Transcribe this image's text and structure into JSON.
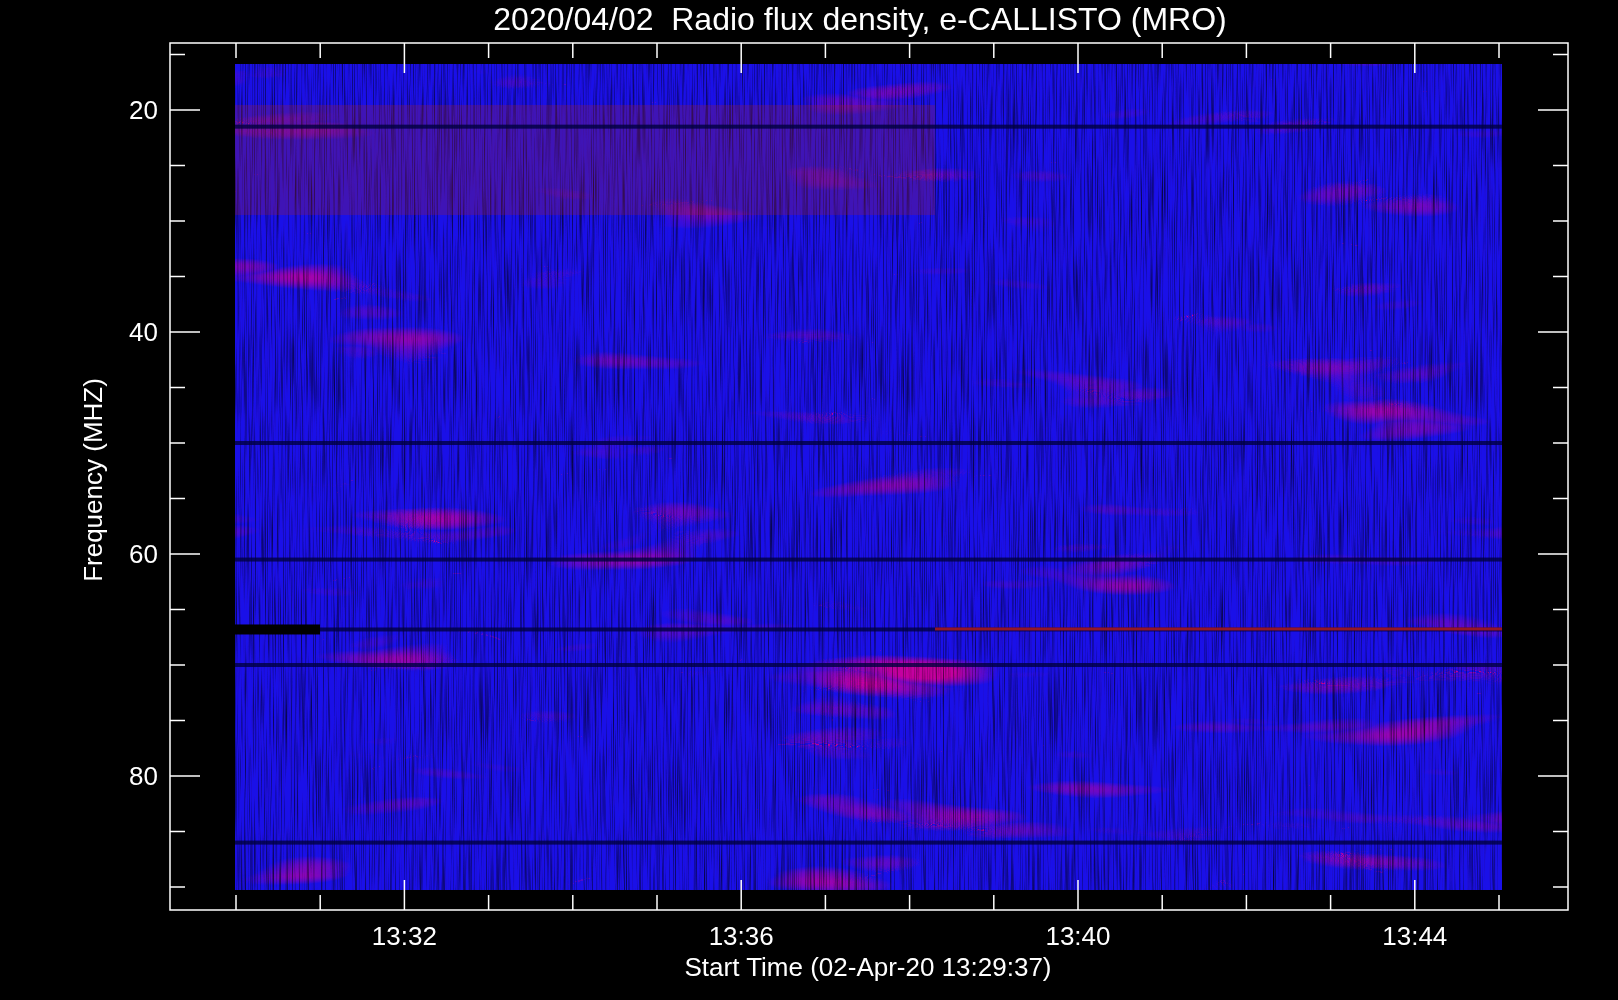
{
  "title": "2020/04/02  Radio flux density, e-CALLISTO (MRO)",
  "y_axis": {
    "label": "Frequency (MHZ)",
    "ticks": [
      "20",
      "40",
      "60",
      "80"
    ]
  },
  "x_axis": {
    "label": "Start Time (02-Apr-20 13:29:37)",
    "ticks": [
      "13:32",
      "13:36",
      "13:40",
      "13:44"
    ]
  }
}
